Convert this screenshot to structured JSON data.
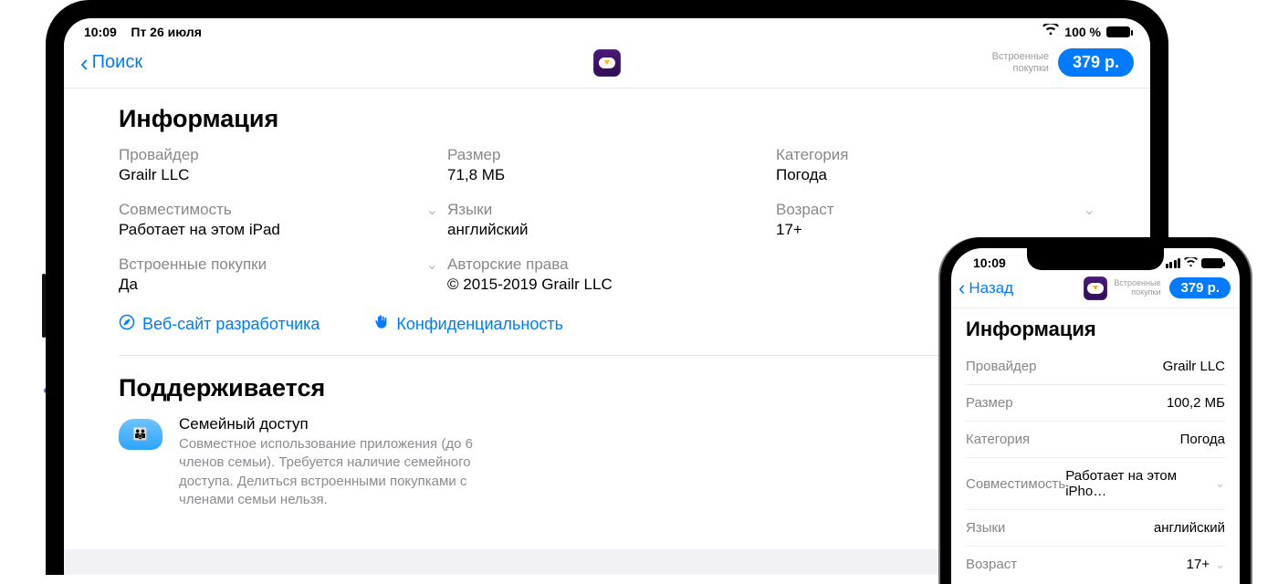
{
  "ipad": {
    "status": {
      "time": "10:09",
      "date": "Пт 26 июля",
      "battery_pct": "100 %"
    },
    "nav": {
      "back_label": "Поиск",
      "iap_line1": "Встроенные",
      "iap_line2": "покупки",
      "price": "379 р."
    },
    "section_title": "Информация",
    "info": {
      "provider_label": "Провайдер",
      "provider_value": "Grailr LLC",
      "size_label": "Размер",
      "size_value": "71,8 МБ",
      "category_label": "Категория",
      "category_value": "Погода",
      "compat_label": "Совместимость",
      "compat_value": "Работает на этом iPad",
      "lang_label": "Языки",
      "lang_value": "английский",
      "age_label": "Возраст",
      "age_value": "17+",
      "iap_label": "Встроенные покупки",
      "iap_value": "Да",
      "copy_label": "Авторские права",
      "copy_value": "© 2015-2019 Grailr LLC"
    },
    "links": {
      "devsite": "Веб-сайт разработчика",
      "privacy": "Конфиденциальность"
    },
    "supports_title": "Поддерживается",
    "family": {
      "title": "Семейный доступ",
      "desc": "Совместное использование приложения (до 6 членов семьи). Требуется наличие семейного доступа. Делиться встроенными покупками с членами семьи нельзя."
    }
  },
  "iphone": {
    "status": {
      "time": "10:09"
    },
    "nav": {
      "back_label": "Назад",
      "iap_line1": "Встроенные",
      "iap_line2": "покупки",
      "price": "379 р."
    },
    "section_title": "Информация",
    "rows": {
      "provider_label": "Провайдер",
      "provider_value": "Grailr LLC",
      "size_label": "Размер",
      "size_value": "100,2 МБ",
      "category_label": "Категория",
      "category_value": "Погода",
      "compat_label": "Совместимость",
      "compat_value": "Работает на этом iPho…",
      "lang_label": "Языки",
      "lang_value": "английский",
      "age_label": "Возраст",
      "age_value": "17+"
    }
  }
}
